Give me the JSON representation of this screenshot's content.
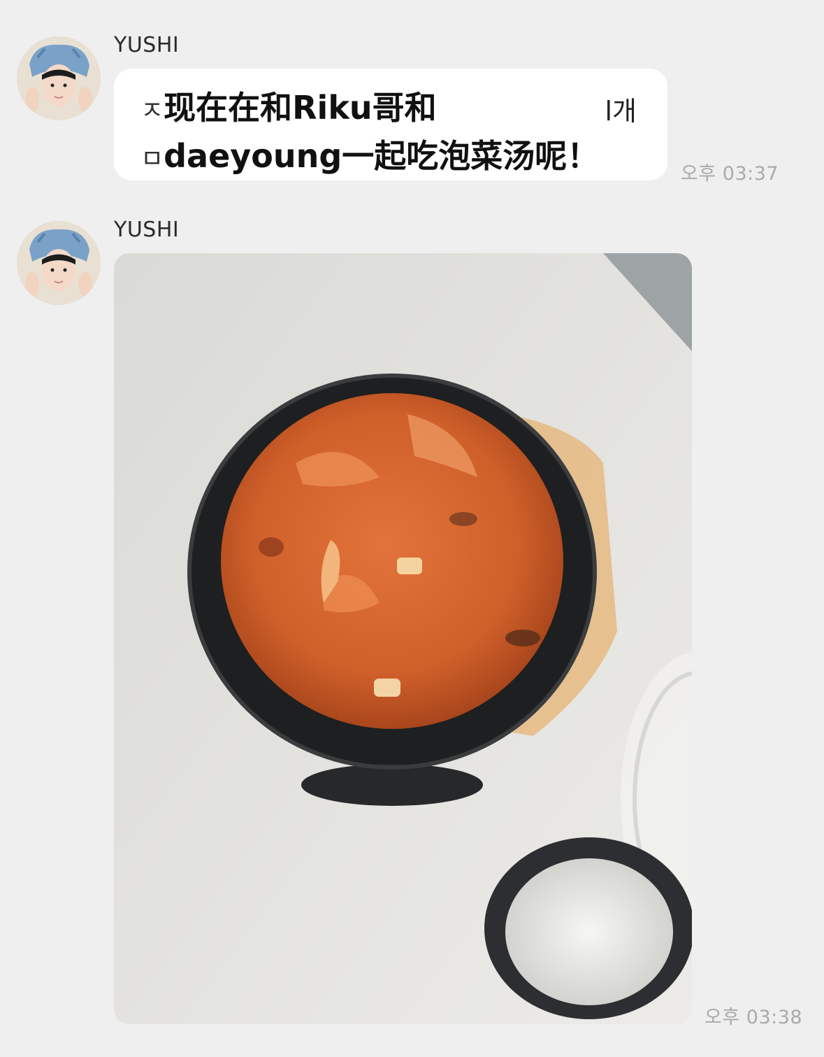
{
  "messages": [
    {
      "sender": "YUSHI",
      "text_line1_prefix": "ㅈ",
      "text_line1": "现在在和Riku哥和",
      "text_line1_trail": "l개",
      "text_line2_prefix": "ㅁ",
      "text_line2": "daeyoung一起吃泡菜汤呢！",
      "time": "오후 03:37"
    },
    {
      "sender": "YUSHI",
      "time": "오후 03:38"
    }
  ],
  "colors": {
    "background": "#efefef",
    "bubble": "#ffffff",
    "timestamp": "#aaaaaa"
  },
  "icons": {
    "avatar": "profile-avatar"
  }
}
